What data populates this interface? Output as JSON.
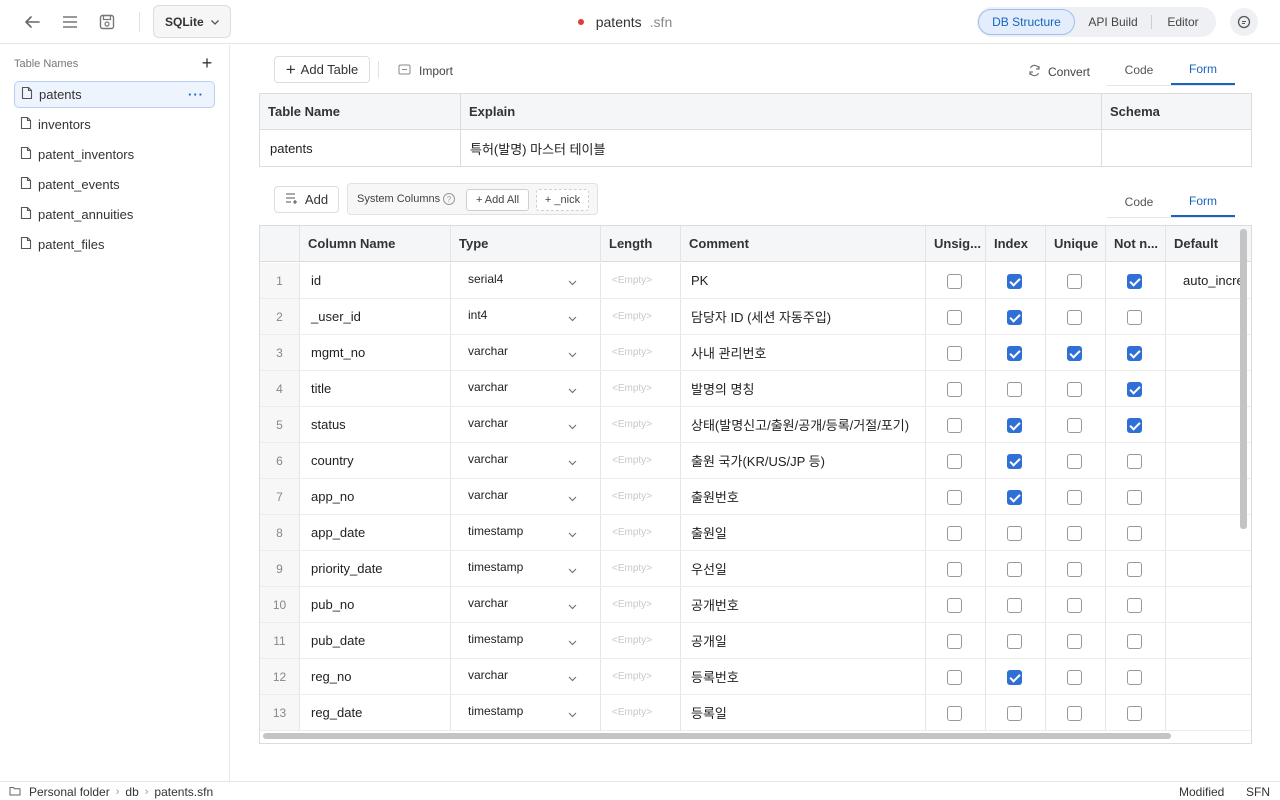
{
  "topbar": {
    "db_engine": "SQLite",
    "file_name": "patents",
    "file_ext": ".sfn",
    "modes": [
      "DB Structure",
      "API Build",
      "Editor"
    ],
    "active_mode": "DB Structure"
  },
  "sidebar": {
    "header": "Table Names",
    "add_label": "+",
    "items": [
      {
        "label": "patents",
        "active": true
      },
      {
        "label": "inventors"
      },
      {
        "label": "patent_inventors"
      },
      {
        "label": "patent_events"
      },
      {
        "label": "patent_annuities"
      },
      {
        "label": "patent_files"
      }
    ]
  },
  "toolbar": {
    "add_table_label": "Add Table",
    "import_label": "Import",
    "convert_label": "Convert",
    "tabs": [
      "Code",
      "Form"
    ],
    "active_tab": "Form"
  },
  "table_info": {
    "headers": [
      "Table Name",
      "Explain",
      "Schema"
    ],
    "table_name": "patents",
    "explain": "특허(발명) 마스터 테이블",
    "schema": ""
  },
  "columns_toolbar": {
    "add_label": "Add",
    "system_columns_label": "System Columns",
    "add_all_label": "+ Add All",
    "nick_label": "+ _nick",
    "tabs": [
      "Code",
      "Form"
    ],
    "active_tab": "Form"
  },
  "grid": {
    "headers": [
      "Column Name",
      "Type",
      "Length",
      "Comment",
      "Unsig...",
      "Index",
      "Unique",
      "Not n...",
      "Default"
    ],
    "empty_placeholder": "<Empty>",
    "rows": [
      {
        "num": "1",
        "name": "id",
        "type": "serial4",
        "comment": "PK",
        "unsigned": false,
        "index": true,
        "unique": false,
        "not_null": true,
        "default": "auto_incre"
      },
      {
        "num": "2",
        "name": "_user_id",
        "type": "int4",
        "comment": "담당자 ID (세션 자동주입)",
        "unsigned": false,
        "index": true,
        "unique": false,
        "not_null": false,
        "default": ""
      },
      {
        "num": "3",
        "name": "mgmt_no",
        "type": "varchar",
        "comment": "사내 관리번호",
        "unsigned": false,
        "index": true,
        "unique": true,
        "not_null": true,
        "default": ""
      },
      {
        "num": "4",
        "name": "title",
        "type": "varchar",
        "comment": "발명의 명칭",
        "unsigned": false,
        "index": false,
        "unique": false,
        "not_null": true,
        "default": ""
      },
      {
        "num": "5",
        "name": "status",
        "type": "varchar",
        "comment": "상태(발명신고/출원/공개/등록/거절/포기)",
        "unsigned": false,
        "index": true,
        "unique": false,
        "not_null": true,
        "default": ""
      },
      {
        "num": "6",
        "name": "country",
        "type": "varchar",
        "comment": "출원 국가(KR/US/JP 등)",
        "unsigned": false,
        "index": true,
        "unique": false,
        "not_null": false,
        "default": ""
      },
      {
        "num": "7",
        "name": "app_no",
        "type": "varchar",
        "comment": "출원번호",
        "unsigned": false,
        "index": true,
        "unique": false,
        "not_null": false,
        "default": ""
      },
      {
        "num": "8",
        "name": "app_date",
        "type": "timestamp",
        "comment": "출원일",
        "unsigned": false,
        "index": false,
        "unique": false,
        "not_null": false,
        "default": ""
      },
      {
        "num": "9",
        "name": "priority_date",
        "type": "timestamp",
        "comment": "우선일",
        "unsigned": false,
        "index": false,
        "unique": false,
        "not_null": false,
        "default": ""
      },
      {
        "num": "10",
        "name": "pub_no",
        "type": "varchar",
        "comment": "공개번호",
        "unsigned": false,
        "index": false,
        "unique": false,
        "not_null": false,
        "default": ""
      },
      {
        "num": "11",
        "name": "pub_date",
        "type": "timestamp",
        "comment": "공개일",
        "unsigned": false,
        "index": false,
        "unique": false,
        "not_null": false,
        "default": ""
      },
      {
        "num": "12",
        "name": "reg_no",
        "type": "varchar",
        "comment": "등록번호",
        "unsigned": false,
        "index": true,
        "unique": false,
        "not_null": false,
        "default": ""
      },
      {
        "num": "13",
        "name": "reg_date",
        "type": "timestamp",
        "comment": "등록일",
        "unsigned": false,
        "index": false,
        "unique": false,
        "not_null": false,
        "default": ""
      }
    ]
  },
  "statusbar": {
    "breadcrumb": [
      "Personal folder",
      "db",
      "patents.sfn"
    ],
    "modified": "Modified",
    "format": "SFN"
  },
  "colors": {
    "accent": "#1565c0",
    "checkbox_on": "#2f6fd6",
    "unsaved_dot": "#e53935"
  }
}
